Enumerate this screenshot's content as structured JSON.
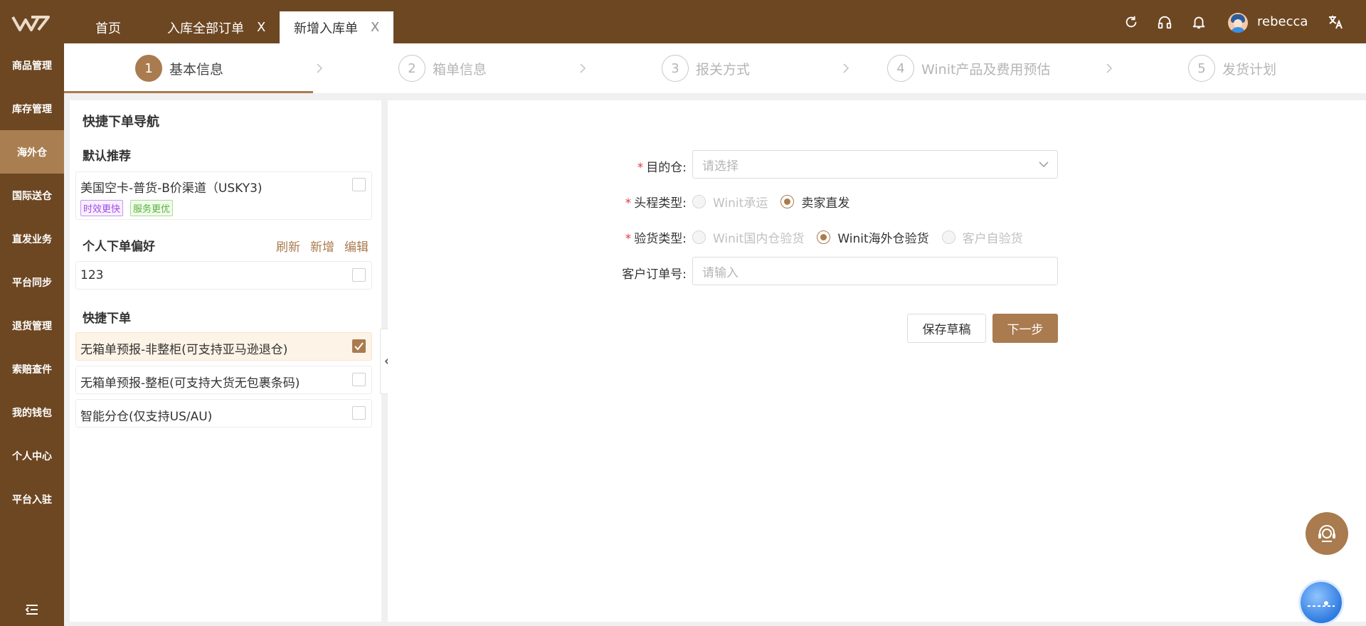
{
  "topbar": {
    "tabs": [
      {
        "label": "首页",
        "closable": false
      },
      {
        "label": "入库全部订单",
        "closable": true
      },
      {
        "label": "新增入库单",
        "closable": true
      }
    ],
    "close_glyph": "X",
    "icons": [
      "refresh-icon",
      "headset-icon",
      "bell-icon",
      "translate-icon"
    ],
    "username": "rebecca",
    "background": "#6d4722"
  },
  "sidebar": {
    "items": [
      "商品管理",
      "库存管理",
      "海外仓",
      "国际送仓",
      "直发业务",
      "平台同步",
      "退货管理",
      "索赔查件",
      "我的钱包",
      "个人中心",
      "平台入驻"
    ],
    "active": "海外仓",
    "active_color": "#a97f52"
  },
  "steps": [
    {
      "num": "1",
      "label": "基本信息",
      "active": true
    },
    {
      "num": "2",
      "label": "箱单信息",
      "active": false
    },
    {
      "num": "3",
      "label": "报关方式",
      "active": false
    },
    {
      "num": "4",
      "label": "Winit产品及费用预估",
      "active": false
    },
    {
      "num": "5",
      "label": "发货计划",
      "active": false
    }
  ],
  "nav": {
    "title": "快捷下单导航",
    "default_section": "默认推荐",
    "default_item": {
      "text": "美国空卡-普货-B价渠道（USKY3)",
      "tags": [
        "时效更快",
        "服务更优"
      ],
      "checked": false
    },
    "pref_section": "个人下单偏好",
    "pref_links": [
      "刷新",
      "新增",
      "编辑"
    ],
    "pref_item": {
      "text": "123",
      "checked": false
    },
    "quick_section": "快捷下单",
    "quick_items": [
      {
        "text": "无箱单预报-非整柜(可支持亚马逊退仓)",
        "checked": true
      },
      {
        "text": "无箱单预报-整柜(可支持大货无包裹条码)",
        "checked": false
      },
      {
        "text": "智能分仓(仅支持US/AU)",
        "checked": false
      }
    ]
  },
  "form": {
    "destination_label": "目的仓:",
    "destination_placeholder": "请选择",
    "leg_type_label": "头程类型:",
    "leg_type_options": [
      {
        "label": "Winit承运",
        "state": "disabled"
      },
      {
        "label": "卖家直发",
        "state": "checked"
      }
    ],
    "inspect_label": "验货类型:",
    "inspect_options": [
      {
        "label": "Winit国内仓验货",
        "state": "disabled"
      },
      {
        "label": "Winit海外仓验货",
        "state": "checked"
      },
      {
        "label": "客户自验货",
        "state": "disabled"
      }
    ],
    "order_no_label": "客户订单号:",
    "order_no_placeholder": "请输入",
    "required_mark": "*",
    "save_draft": "保存草稿",
    "next": "下一步"
  },
  "accent_color": "#a97b4f"
}
